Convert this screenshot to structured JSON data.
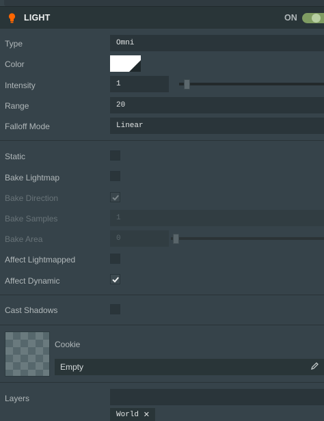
{
  "header": {
    "title": "LIGHT",
    "toggle_label": "ON",
    "enabled": true,
    "icon": "lightbulb-icon",
    "accent": "#ff6600"
  },
  "fields": {
    "type": {
      "label": "Type",
      "value": "Omni"
    },
    "color": {
      "label": "Color",
      "value": "#ffffff"
    },
    "intensity": {
      "label": "Intensity",
      "value": "1",
      "slider_fraction": 0.02
    },
    "range": {
      "label": "Range",
      "value": "20"
    },
    "falloff": {
      "label": "Falloff Mode",
      "value": "Linear"
    }
  },
  "bake": {
    "static": {
      "label": "Static",
      "checked": false
    },
    "bake_lightmap": {
      "label": "Bake Lightmap",
      "checked": false
    },
    "bake_direction": {
      "label": "Bake Direction",
      "checked": true,
      "disabled": true
    },
    "bake_samples": {
      "label": "Bake Samples",
      "value": "1",
      "disabled": true
    },
    "bake_area": {
      "label": "Bake Area",
      "value": "0",
      "disabled": true,
      "slider_fraction": 0
    },
    "affect_lightmapped": {
      "label": "Affect Lightmapped",
      "checked": false
    },
    "affect_dynamic": {
      "label": "Affect Dynamic",
      "checked": true
    }
  },
  "shadows": {
    "cast_shadows": {
      "label": "Cast Shadows",
      "checked": false
    }
  },
  "cookie": {
    "label": "Cookie",
    "asset_value": "Empty",
    "edit_icon": "pencil-icon"
  },
  "layers": {
    "label": "Layers",
    "search_value": "",
    "tags": [
      {
        "name": "World",
        "remove_icon": "close-icon"
      }
    ]
  }
}
